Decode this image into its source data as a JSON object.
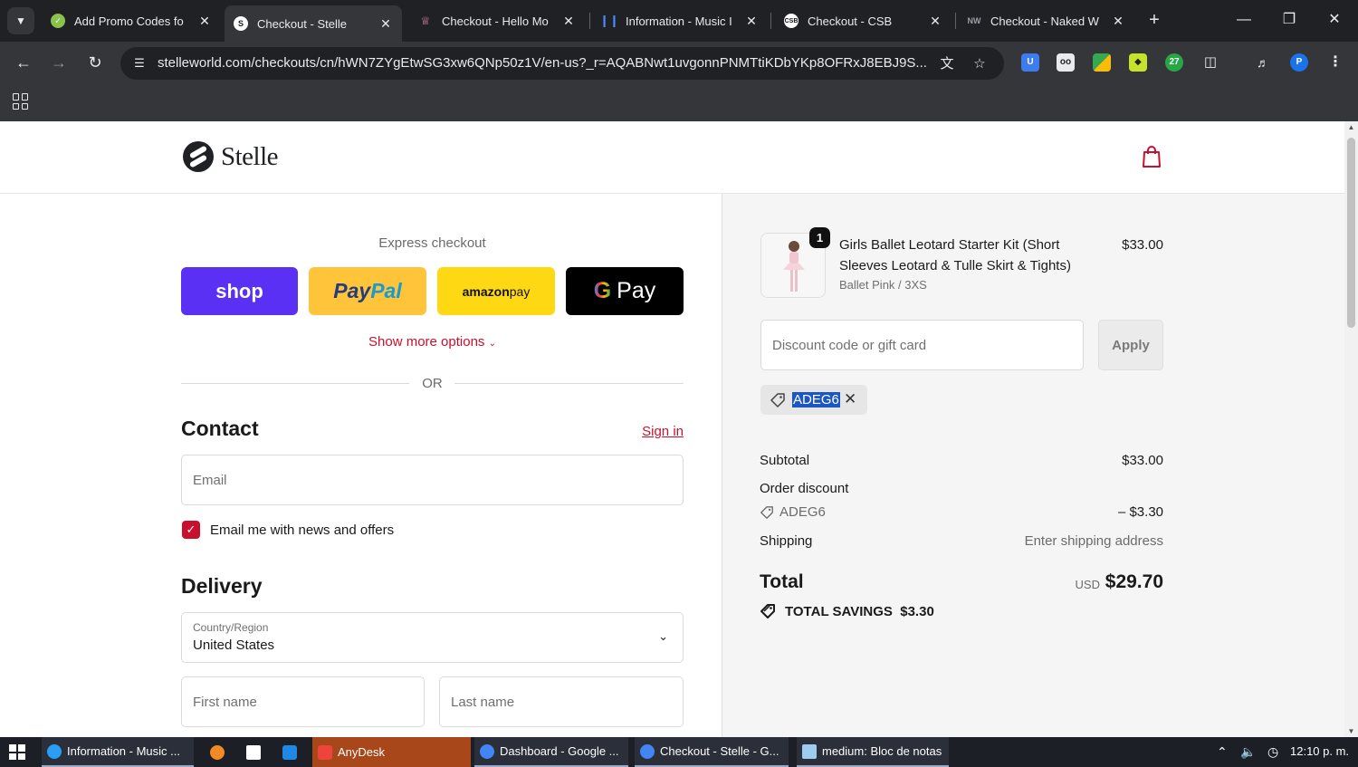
{
  "browser": {
    "tabs": [
      {
        "title": "Add Promo Codes fo",
        "favicon": "check-circle-icon",
        "color": "#8bc34a",
        "active": false
      },
      {
        "title": "Checkout - Stelle",
        "favicon": "stelle-logo-icon",
        "color": "#ffffff",
        "active": true
      },
      {
        "title": "Checkout - Hello Mo",
        "favicon": "crown-icon",
        "color": "#f48fb1",
        "active": false
      },
      {
        "title": "Information - Music I",
        "favicon": "music-bars-icon",
        "color": "#4a8cff",
        "active": false
      },
      {
        "title": "Checkout - CSB",
        "favicon": "csb-icon",
        "color": "#ffffff",
        "active": false
      },
      {
        "title": "Checkout - Naked W",
        "favicon": "nw-icon",
        "color": "#333333",
        "active": false
      }
    ],
    "url": "stelleworld.com/checkouts/cn/hWN7ZYgEtwSG3xw6QNp50z1V/en-us?_r=AQABNwt1uvgonnPNMTtiKDbYKp8OFRxJ8EBJ9S...",
    "extensions": [
      {
        "name": "shield-extension-icon",
        "color": "#3d7bf0",
        "label": "U"
      },
      {
        "name": "glasses-extension-icon",
        "color": "#e8eaed",
        "label": "oo"
      },
      {
        "name": "grid-extension-icon",
        "color": "#34a853",
        "label": ""
      },
      {
        "name": "tag-extension-icon",
        "color": "#c6e22b",
        "label": ""
      },
      {
        "name": "coupon-extension-icon",
        "color": "#28a745",
        "label": "27"
      },
      {
        "name": "puzzle-extension-icon",
        "color": "#e8eaed",
        "label": ""
      }
    ],
    "profile_initial": "P"
  },
  "store": {
    "name": "Stelle"
  },
  "express": {
    "title": "Express checkout",
    "shop_label": "shop",
    "paypal_label_1": "Pay",
    "paypal_label_2": "Pal",
    "amazon_label_1": "amazon",
    "amazon_label_2": " pay",
    "gpay_label_g": "G",
    "gpay_label": "Pay",
    "more_options": "Show more options",
    "or": "OR"
  },
  "contact": {
    "title": "Contact",
    "sign_in": "Sign in",
    "email_placeholder": "Email",
    "newsletter_label": "Email me with news and offers",
    "newsletter_checked": true
  },
  "delivery": {
    "title": "Delivery",
    "country_label": "Country/Region",
    "country_value": "United States",
    "first_name_placeholder": "First name",
    "last_name_placeholder": "Last name"
  },
  "summary": {
    "item": {
      "quantity": "1",
      "name": "Girls Ballet Leotard Starter Kit (Short Sleeves Leotard & Tulle Skirt & Tights)",
      "variant": "Ballet Pink / 3XS",
      "price": "$33.00"
    },
    "discount_placeholder": "Discount code or gift card",
    "apply_label": "Apply",
    "applied_code": "ADEG6",
    "subtotal_label": "Subtotal",
    "subtotal_value": "$33.00",
    "order_discount_label": "Order discount",
    "order_discount_code": "ADEG6",
    "order_discount_value": "– $3.30",
    "shipping_label": "Shipping",
    "shipping_value": "Enter shipping address",
    "total_label": "Total",
    "currency": "USD",
    "total_value": "$29.70",
    "savings_label": "TOTAL SAVINGS",
    "savings_value": "$3.30"
  },
  "accent_color": "#c8102e",
  "taskbar": {
    "items": [
      {
        "label": "Information - Music ...",
        "icon": "edge-icon",
        "color": "#2a9df4"
      },
      {
        "label": "",
        "icon": "vlc-icon",
        "color": "#f08a24"
      },
      {
        "label": "",
        "icon": "file-icon",
        "color": "#ffffff"
      },
      {
        "label": "",
        "icon": "app-icon",
        "color": "#1e88e5"
      },
      {
        "label": "AnyDesk",
        "icon": "anydesk-icon",
        "color": "#ef443b"
      },
      {
        "label": "Dashboard - Google ...",
        "icon": "chrome-icon",
        "color": "#4285f4"
      },
      {
        "label": "Checkout - Stelle - G...",
        "icon": "chrome-icon",
        "color": "#4285f4"
      },
      {
        "label": "medium: Bloc de notas",
        "icon": "notepad-icon",
        "color": "#9ecbf0"
      }
    ],
    "clock": "12:10 p. m."
  }
}
